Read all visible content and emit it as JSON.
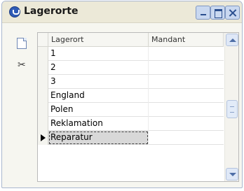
{
  "window": {
    "title": "Lagerorte",
    "controls": [
      "minimize",
      "maximize",
      "close"
    ]
  },
  "toolbar": {
    "items": [
      {
        "icon": "new-document-icon"
      },
      {
        "icon": "scissors-icon"
      }
    ]
  },
  "grid": {
    "columns": [
      "Lagerort",
      "Mandant"
    ],
    "rows": [
      {
        "lagerort": "1",
        "mandant": ""
      },
      {
        "lagerort": "2",
        "mandant": ""
      },
      {
        "lagerort": "3",
        "mandant": ""
      },
      {
        "lagerort": "England",
        "mandant": ""
      },
      {
        "lagerort": "Polen",
        "mandant": ""
      },
      {
        "lagerort": "Reklamation",
        "mandant": ""
      },
      {
        "lagerort": "Reparatur",
        "mandant": ""
      }
    ],
    "current_row": 6
  }
}
